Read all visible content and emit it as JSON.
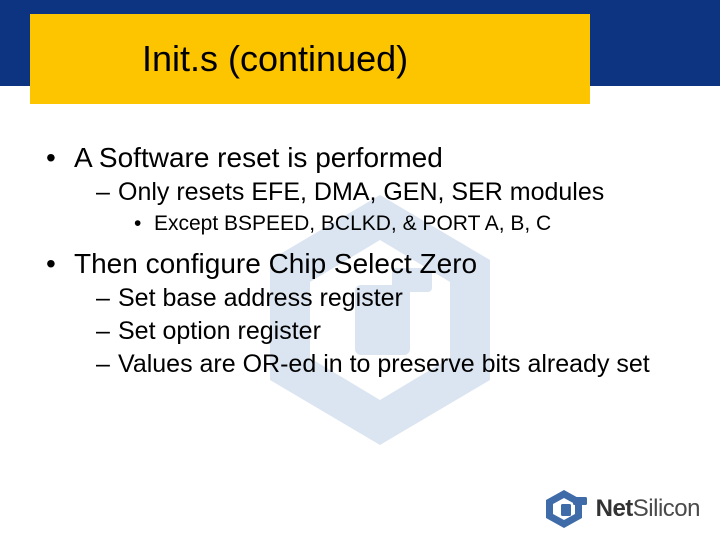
{
  "title": "Init.s (continued)",
  "bullets": {
    "b1": "A Software reset is performed",
    "b1_1": "Only resets EFE, DMA, GEN, SER modules",
    "b1_1_1": "Except BSPEED, BCLKD, & PORT A, B, C",
    "b2": "Then configure Chip Select Zero",
    "b2_1": "Set base address register",
    "b2_2": "Set option register",
    "b2_3": "Values are OR-ed in to preserve bits already set"
  },
  "logo": {
    "net": "Net",
    "silicon": "Silicon"
  },
  "colors": {
    "band": "#0d3481",
    "title_bg": "#fdc400",
    "logo_mark": "#3f6ba8",
    "wm": "#dbe5f1"
  }
}
